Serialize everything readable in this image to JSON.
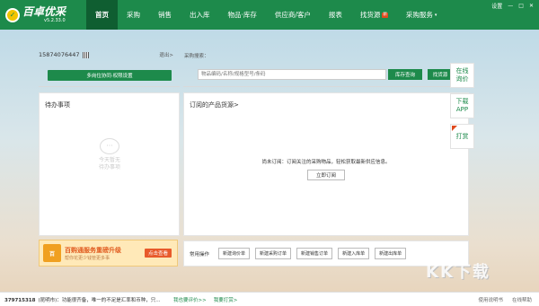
{
  "app": {
    "brand": "百卓优采",
    "version": "v5.2.33.0",
    "logo_icon": "leaf-logo-icon"
  },
  "nav": {
    "items": [
      {
        "label": "首页",
        "active": true
      },
      {
        "label": "采购"
      },
      {
        "label": "销售"
      },
      {
        "label": "出入库"
      },
      {
        "label": "物品·库存"
      },
      {
        "label": "供应商/客户"
      },
      {
        "label": "报表"
      },
      {
        "label": "找货源",
        "badge": "新"
      },
      {
        "label": "采购服务"
      }
    ]
  },
  "window": {
    "settings": "设置",
    "minimize": "—",
    "maximize": "□",
    "close": "✕"
  },
  "user": {
    "phone": "15874076447",
    "logout": "退出>",
    "setting_button": "多岗位协同·权限设置"
  },
  "search": {
    "title": "采购搜索：",
    "placeholder": "物品编码/名称/规格型号/条码",
    "query_button": "库存查询",
    "find_button": "找货源"
  },
  "todo": {
    "title": "待办事项",
    "empty_line1": "今天暂无",
    "empty_line2": "待办事项"
  },
  "subscribed": {
    "title": "订阅的产品货源>",
    "notice": "尚未订阅：订阅关注的采购物品，轻松获取最新供应信息。",
    "subscribe_button": "立即订阅"
  },
  "side": {
    "inquiry_line1": "在线",
    "inquiry_line2": "询价",
    "download_line1": "下载",
    "download_line2": "APP",
    "checkin": "打赏"
  },
  "promo": {
    "icon_text": "百",
    "title": "百购通服务重磅升级",
    "subtitle": "帮你花更少钱管更多事",
    "button": "点击查看"
  },
  "ops": {
    "label": "常用操作",
    "buttons": [
      "新建询价单",
      "新建采购订单",
      "新建销售订单",
      "新建入库单",
      "新建出库单"
    ]
  },
  "status": {
    "qq": "379715318",
    "message": "(昆明市)：功能很齐备，唯一的不足是汇率和币种，只...",
    "evaluate": "我也要评价>>",
    "reward": "我要打赏>",
    "help": "使用说明书",
    "online": "在线帮助"
  },
  "watermark": "KK下载",
  "colors": {
    "brand_green": "#1d8a4b",
    "active_nav": "#0f5e31",
    "accent_orange": "#e85a2b"
  }
}
